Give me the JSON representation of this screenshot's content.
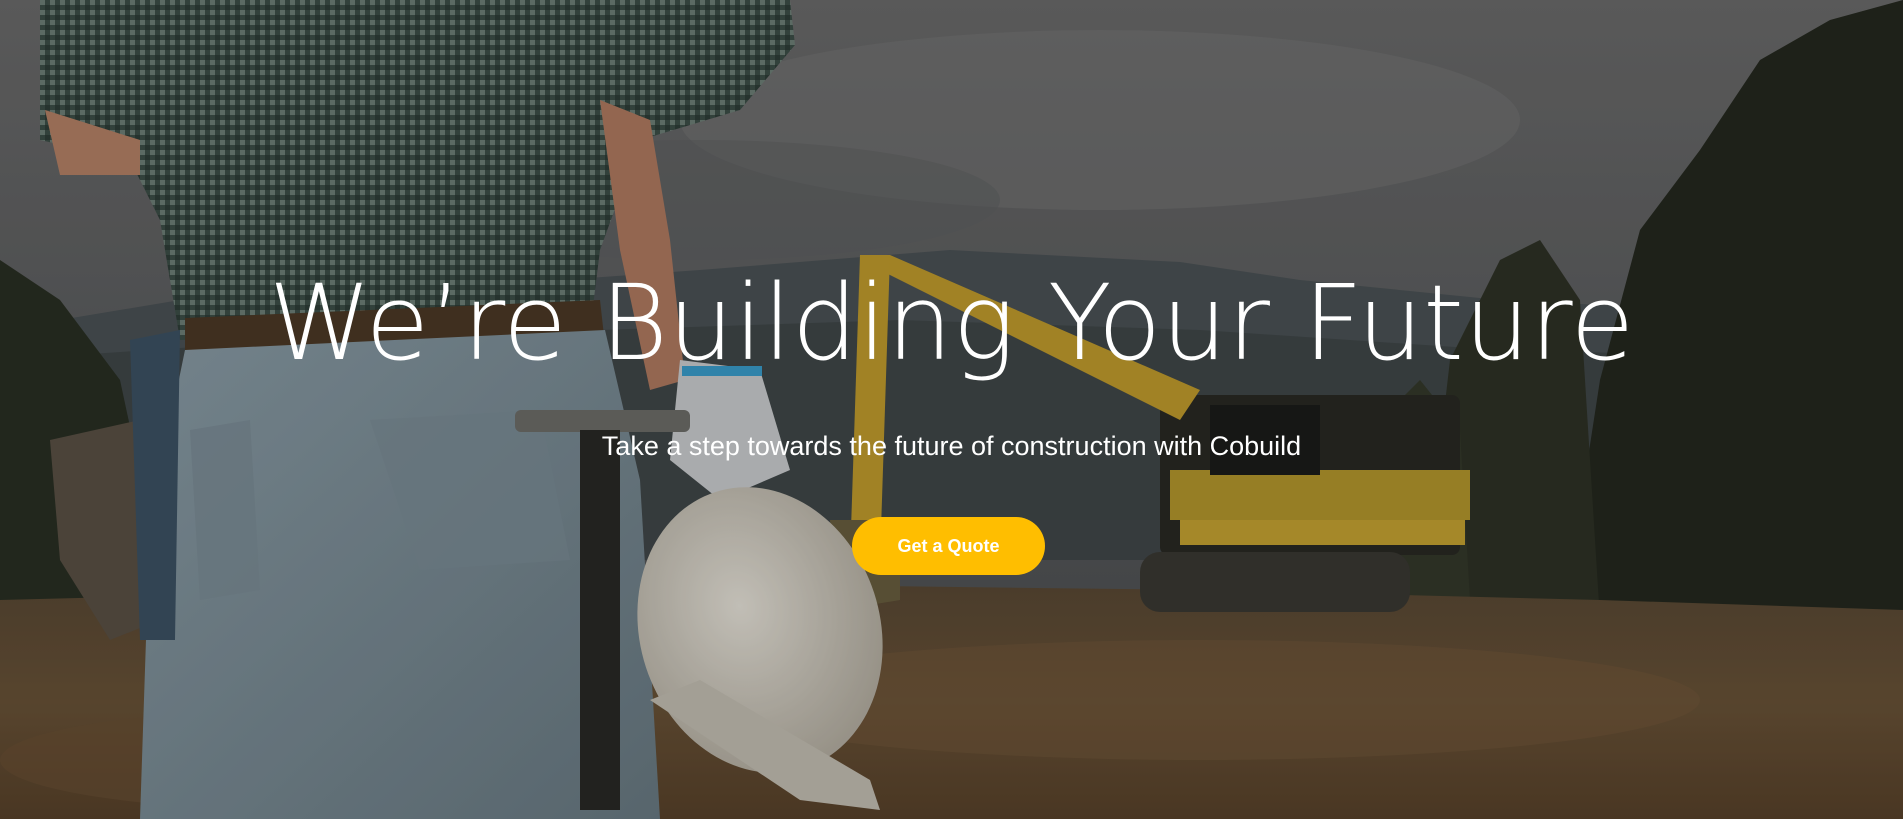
{
  "hero": {
    "headline": "We’re Building Your Future",
    "subheadline": "Take a step towards the future of construction with Cobuild",
    "cta_label": "Get a Quote"
  },
  "colors": {
    "accent": "#ffbe00",
    "text": "#ffffff"
  },
  "icons": {
    "background": "construction-worker-with-excavator-photo"
  }
}
